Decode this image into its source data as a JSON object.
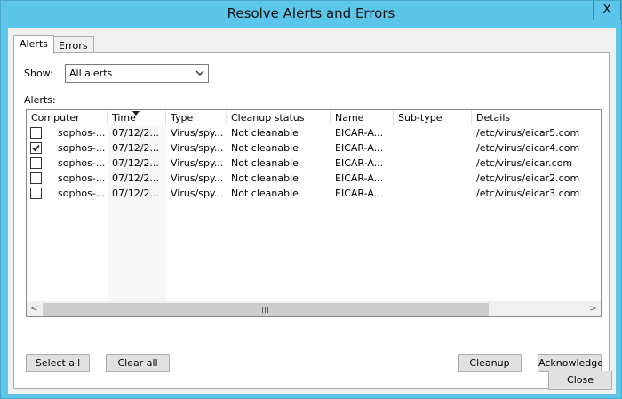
{
  "window": {
    "title": "Resolve Alerts and Errors",
    "close_glyph": "X"
  },
  "tabs": [
    {
      "label": "Alerts"
    },
    {
      "label": "Errors"
    }
  ],
  "filter": {
    "show_label": "Show:",
    "selected": "All alerts"
  },
  "alerts_label": "Alerts:",
  "table": {
    "columns": [
      "Computer",
      "Time",
      "Type",
      "Cleanup status",
      "Name",
      "Sub-type",
      "Details"
    ],
    "sort_column": "Time",
    "rows": [
      {
        "checked": false,
        "computer": "sophos-...",
        "time": "07/12/2...",
        "type": "Virus/spy...",
        "status": "Not cleanable",
        "name": "EICAR-A...",
        "subtype": "",
        "details": "/etc/virus/eicar5.com"
      },
      {
        "checked": true,
        "computer": "sophos-...",
        "time": "07/12/2...",
        "type": "Virus/spy...",
        "status": "Not cleanable",
        "name": "EICAR-A...",
        "subtype": "",
        "details": "/etc/virus/eicar4.com"
      },
      {
        "checked": false,
        "computer": "sophos-...",
        "time": "07/12/2...",
        "type": "Virus/spy...",
        "status": "Not cleanable",
        "name": "EICAR-A...",
        "subtype": "",
        "details": "/etc/virus/eicar.com"
      },
      {
        "checked": false,
        "computer": "sophos-...",
        "time": "07/12/2...",
        "type": "Virus/spy...",
        "status": "Not cleanable",
        "name": "EICAR-A...",
        "subtype": "",
        "details": "/etc/virus/eicar2.com"
      },
      {
        "checked": false,
        "computer": "sophos-...",
        "time": "07/12/2...",
        "type": "Virus/spy...",
        "status": "Not cleanable",
        "name": "EICAR-A...",
        "subtype": "",
        "details": "/etc/virus/eicar3.com"
      }
    ]
  },
  "scrollbar": {
    "left": "<",
    "right": ">",
    "grip": "III"
  },
  "buttons": {
    "select_all": "Select all",
    "clear_all": "Clear all",
    "cleanup": "Cleanup",
    "acknowledge": "Acknowledge",
    "close": "Close"
  }
}
